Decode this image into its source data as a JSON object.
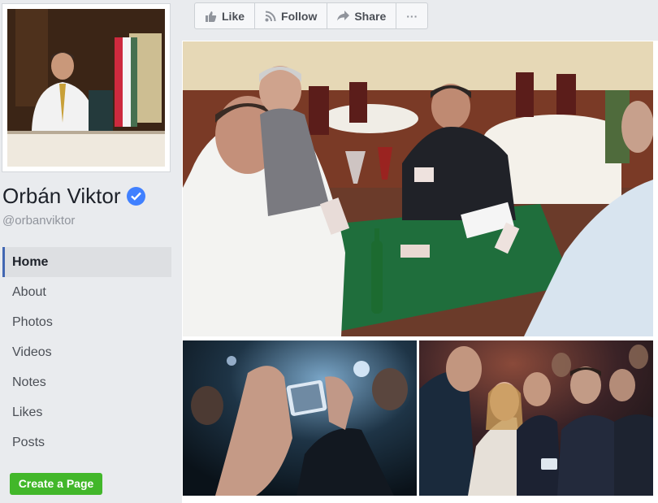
{
  "page": {
    "name": "Orbán Viktor",
    "handle": "@orbanviktor"
  },
  "nav": {
    "items": [
      {
        "label": "Home",
        "active": true
      },
      {
        "label": "About"
      },
      {
        "label": "Photos"
      },
      {
        "label": "Videos"
      },
      {
        "label": "Notes"
      },
      {
        "label": "Likes"
      },
      {
        "label": "Posts"
      }
    ]
  },
  "create_page_label": "Create a Page",
  "actions": {
    "like": "Like",
    "follow": "Follow",
    "share": "Share",
    "more": "···"
  },
  "colors": {
    "brand_blue": "#4267b2",
    "verified_blue": "#4080ff",
    "create_green": "#42b72a"
  },
  "icons": {
    "like": "thumbs-up-icon",
    "follow": "rss-icon",
    "share": "share-arrow-icon",
    "verified": "verified-check-icon"
  }
}
